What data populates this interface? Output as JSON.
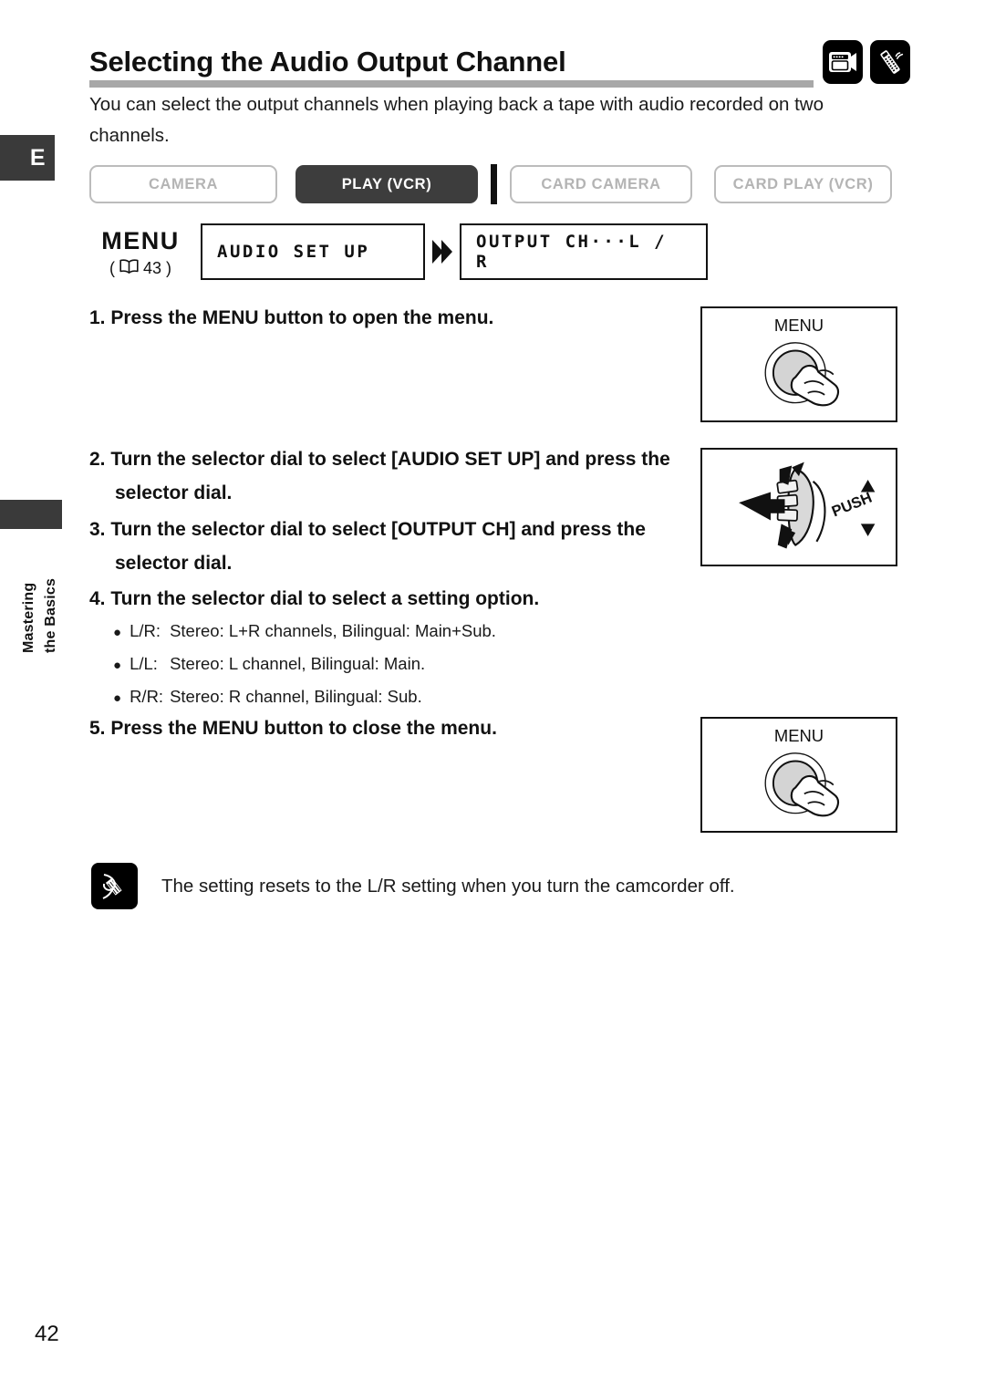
{
  "sidebar": {
    "language_tab": "E",
    "chapter_line_1": "Mastering",
    "chapter_line_2": "the Basics"
  },
  "header": {
    "title": "Selecting the Audio Output Channel",
    "intro": "You can select the output channels when playing back a tape with audio recorded on two channels.",
    "icons": [
      {
        "name": "camcorder-icon",
        "label": "camcorder"
      },
      {
        "name": "remote-control-icon",
        "label": "remote control"
      }
    ]
  },
  "mode_tabs": [
    {
      "label": "CAMERA",
      "active": false
    },
    {
      "label": "PLAY (VCR)",
      "active": true
    },
    {
      "label": "CARD CAMERA",
      "active": false
    },
    {
      "label": "CARD PLAY (VCR)",
      "active": false
    }
  ],
  "menu_path": {
    "label": "MENU",
    "reference": "43",
    "reference_prefix": "(",
    "reference_suffix": ")",
    "box_1": "AUDIO SET UP",
    "box_2": "OUTPUT CH···L / R"
  },
  "steps": [
    {
      "number": "1.",
      "text": "Press the MENU button to open the menu."
    },
    {
      "number": "2.",
      "text": "Turn the selector dial to select [AUDIO SET UP] and press the selector dial."
    },
    {
      "number": "3.",
      "text": "Turn the selector dial to select [OUTPUT CH] and press the selector dial."
    },
    {
      "number": "4.",
      "text": "Turn the selector dial to select a setting option."
    },
    {
      "number": "5.",
      "text": "Press the MENU button to close the menu."
    }
  ],
  "options": [
    {
      "key": "L/R:",
      "text": "Stereo: L+R channels, Bilingual: Main+Sub."
    },
    {
      "key": "L/L:",
      "text": "Stereo: L channel, Bilingual: Main."
    },
    {
      "key": "R/R:",
      "text": "Stereo: R channel, Bilingual: Sub."
    }
  ],
  "illustrations": {
    "menu_button_label": "MENU",
    "dial_push_label": "PUSH"
  },
  "note": {
    "text": "The setting resets to the L/R setting when you turn the camcorder off."
  },
  "footer": {
    "page_number": "42"
  },
  "colors": {
    "active_tab_bg": "#3d3d3d",
    "inactive_tab_border": "#bcbcbc",
    "inactive_tab_text": "#b4b4b4",
    "title_rule": "#a8a8a8",
    "ink": "#111111",
    "button_gray": "#d4d4d4"
  }
}
